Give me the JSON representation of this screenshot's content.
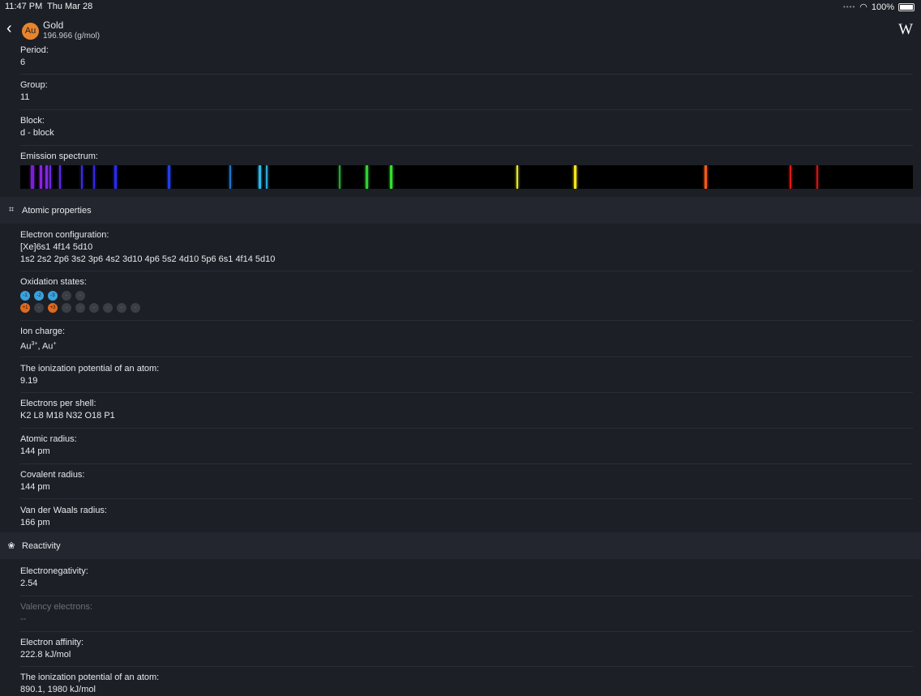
{
  "status": {
    "time": "11:47 PM",
    "date": "Thu Mar 28",
    "battery": "100%",
    "wifi_icon": "wifi-icon",
    "battery_icon": "battery-icon"
  },
  "header": {
    "symbol": "Au",
    "name": "Gold",
    "mass": "196.966 (g/mol)",
    "wiki_label": "W",
    "symbol_color": "#e8842c"
  },
  "basic": {
    "period": {
      "label": "Period:",
      "value": "6"
    },
    "group": {
      "label": "Group:",
      "value": "11"
    },
    "block": {
      "label": "Block:",
      "value": "d - block"
    },
    "spectrum": {
      "label": "Emission spectrum:"
    }
  },
  "spectrum_lines": [
    {
      "pos": 0.012,
      "color": "#7a1fd6",
      "w": 4
    },
    {
      "pos": 0.022,
      "color": "#8a22e0",
      "w": 3
    },
    {
      "pos": 0.028,
      "color": "#7d2ae0",
      "w": 3
    },
    {
      "pos": 0.033,
      "color": "#6a28d8",
      "w": 2
    },
    {
      "pos": 0.044,
      "color": "#5a2ae0",
      "w": 2
    },
    {
      "pos": 0.068,
      "color": "#3a2be0",
      "w": 2
    },
    {
      "pos": 0.082,
      "color": "#3426e8",
      "w": 2
    },
    {
      "pos": 0.105,
      "color": "#2a2aeb",
      "w": 3
    },
    {
      "pos": 0.165,
      "color": "#1f3fe8",
      "w": 3
    },
    {
      "pos": 0.234,
      "color": "#1f74c8",
      "w": 2
    },
    {
      "pos": 0.267,
      "color": "#2bb8e6",
      "w": 3
    },
    {
      "pos": 0.275,
      "color": "#2ea6d8",
      "w": 2
    },
    {
      "pos": 0.357,
      "color": "#22a838",
      "w": 2
    },
    {
      "pos": 0.387,
      "color": "#30d035",
      "w": 3
    },
    {
      "pos": 0.414,
      "color": "#38dd30",
      "w": 3
    },
    {
      "pos": 0.556,
      "color": "#e5e52a",
      "w": 2
    },
    {
      "pos": 0.62,
      "color": "#f5e31a",
      "w": 3
    },
    {
      "pos": 0.767,
      "color": "#f05a1a",
      "w": 3
    },
    {
      "pos": 0.862,
      "color": "#e01818",
      "w": 2
    },
    {
      "pos": 0.892,
      "color": "#cc1515",
      "w": 2
    }
  ],
  "atomic": {
    "title": "Atomic properties",
    "icon": "atom-icon",
    "electron_config": {
      "label": "Electron configuration:",
      "short": "[Xe]6s1 4f14 5d10",
      "full": "1s2 2s2 2p6 3s2 3p6 4s2 3d10 4p6 5s2 4d10 5p6 6s1 4f14 5d10"
    },
    "oxidation": {
      "label": "Oxidation states:",
      "negative": [
        "-1",
        "-2",
        "-3",
        "-",
        "-"
      ],
      "positive": [
        "+1",
        "-",
        "+3",
        "-",
        "-",
        "-",
        "-",
        "-",
        "-"
      ],
      "neg_active": [
        true,
        true,
        true,
        false,
        false
      ],
      "pos_active": [
        true,
        false,
        true,
        false,
        false,
        false,
        false,
        false,
        false
      ],
      "neg_color": "#3aa1de",
      "pos_color": "#e06a1e"
    },
    "ion_charge": {
      "label": "Ion charge:",
      "base1": "Au",
      "sup1": "3+",
      "sep": ", ",
      "base2": "Au",
      "sup2": "+"
    },
    "ionization": {
      "label": "The ionization potential of an atom:",
      "value": "9.19"
    },
    "shells": {
      "label": "Electrons per shell:",
      "value": "K2 L8 M18 N32 O18 P1"
    },
    "atomic_radius": {
      "label": "Atomic radius:",
      "value": "144 pm"
    },
    "covalent_radius": {
      "label": "Covalent radius:",
      "value": "144 pm"
    },
    "vdw_radius": {
      "label": "Van der Waals radius:",
      "value": "166 pm"
    }
  },
  "reactivity": {
    "title": "Reactivity",
    "icon": "reactivity-icon",
    "electronegativity": {
      "label": "Electronegativity:",
      "value": "2.54"
    },
    "valency": {
      "label": "Valency electrons:",
      "value": "--"
    },
    "affinity": {
      "label": "Electron affinity:",
      "value": "222.8 kJ/mol"
    },
    "ionization": {
      "label": "The ionization potential of an atom:",
      "value": "890.1, 1980 kJ/mol"
    }
  }
}
